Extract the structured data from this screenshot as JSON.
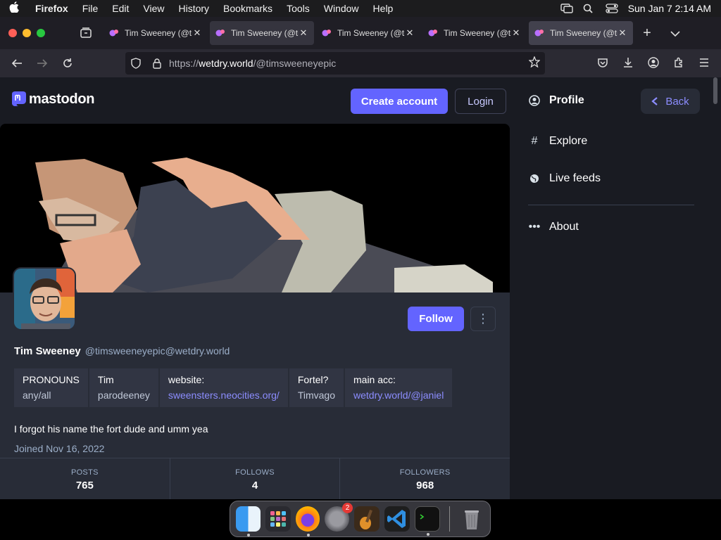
{
  "menubar": {
    "app_name": "Firefox",
    "items": [
      "File",
      "Edit",
      "View",
      "History",
      "Bookmarks",
      "Tools",
      "Window",
      "Help"
    ],
    "clock": "Sun Jan 7  2:14 AM"
  },
  "browser": {
    "tabs": [
      {
        "title": "Tim Sweeney (@timsweeneyepic@wetdry.world)"
      },
      {
        "title": "Tim Sweeney (@timsweeneyepic@wetdry.world)"
      },
      {
        "title": "Tim Sweeney (@timsweeneyepic@wetdry.world)"
      },
      {
        "title": "Tim Sweeney (@timsweeneyepic@wetdry.world)"
      },
      {
        "title": "Tim Sweeney (@timsweeneyepic@wetdry.world)"
      }
    ],
    "url_prefix": "https://",
    "url_domain": "wetdry.world",
    "url_path": "/@timsweeneyepic"
  },
  "page": {
    "logo_text": "mastodon",
    "create_account_label": "Create account",
    "login_label": "Login"
  },
  "profile": {
    "follow_label": "Follow",
    "more_glyph": "⋮",
    "display_name": "Tim Sweeney",
    "handle": "@timsweeneyepic@wetdry.world",
    "fields": [
      {
        "key": "PRONOUNS",
        "value": "any/all",
        "link": false
      },
      {
        "key": "Tim",
        "value": "parodeeney",
        "link": false
      },
      {
        "key": "website:",
        "value": "sweensters.neocities.org/",
        "link": true
      },
      {
        "key": "Fortel?",
        "value": "Timvago",
        "link": false
      },
      {
        "key": "main acc:",
        "value": "wetdry.world/@janiel",
        "link": true
      }
    ],
    "bio": "I forgot his name the fort dude and umm yea",
    "joined": "Joined Nov 16, 2022",
    "stats": [
      {
        "label": "POSTS",
        "value": "765"
      },
      {
        "label": "FOLLOWS",
        "value": "4"
      },
      {
        "label": "FOLLOWERS",
        "value": "968"
      }
    ]
  },
  "sidebar": {
    "profile_label": "Profile",
    "back_label": "Back",
    "explore_label": "Explore",
    "live_feeds_label": "Live feeds",
    "about_label": "About"
  },
  "dock": {
    "settings_badge": "2"
  },
  "colors": {
    "accent": "#6364ff",
    "page_bg": "#191b22",
    "card_bg": "#282c37",
    "link": "#8c8dff"
  }
}
